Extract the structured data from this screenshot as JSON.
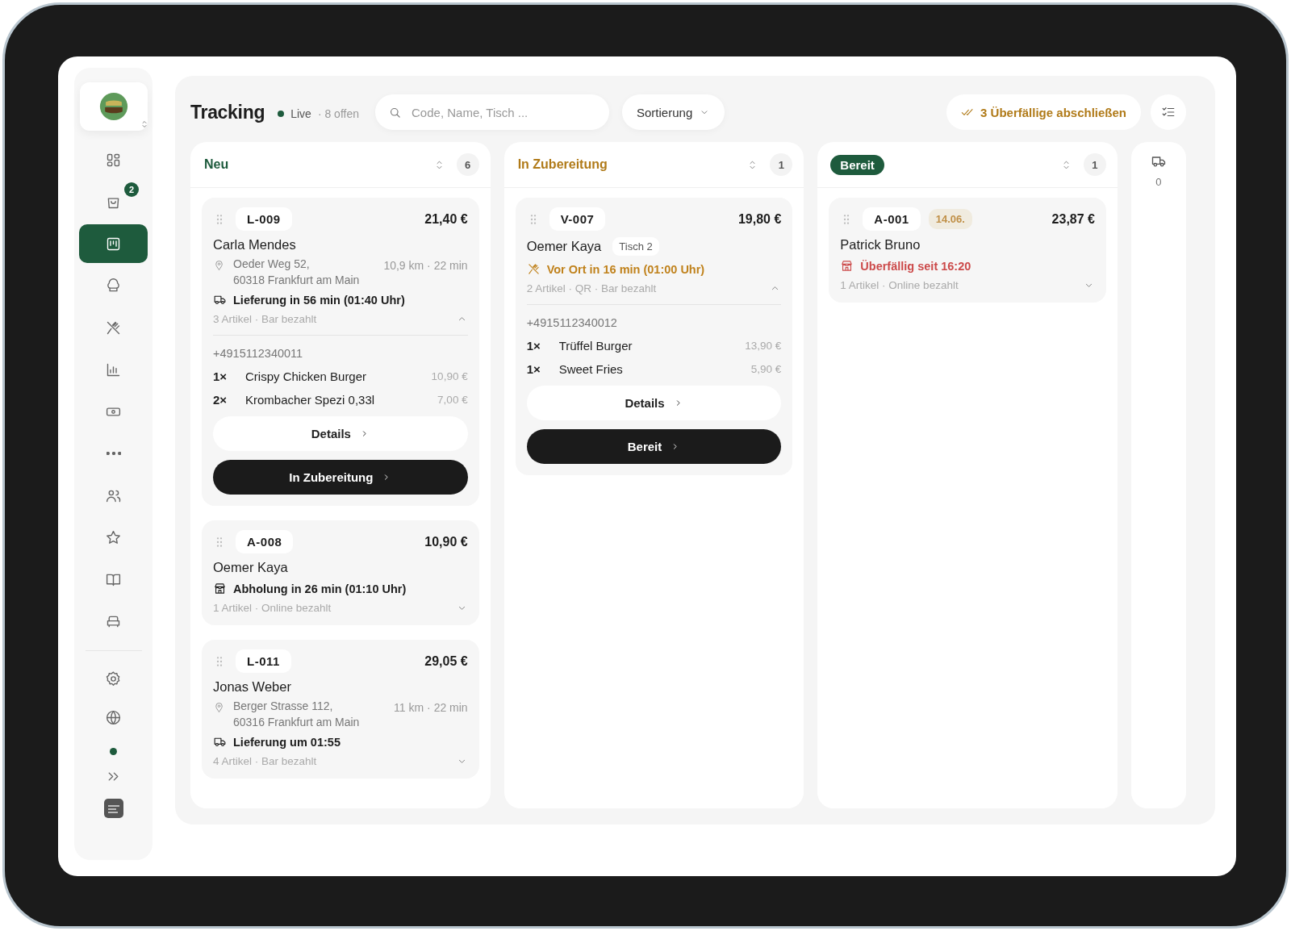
{
  "sidebar": {
    "nav": [
      {
        "kind": "grid",
        "selected": false
      },
      {
        "kind": "bag",
        "selected": false,
        "badge": "2"
      },
      {
        "kind": "board",
        "selected": true
      },
      {
        "kind": "chef",
        "selected": false
      },
      {
        "kind": "cutlery",
        "selected": false
      },
      {
        "kind": "chart",
        "selected": false
      },
      {
        "kind": "cash",
        "selected": false
      },
      {
        "kind": "more",
        "selected": false
      },
      {
        "kind": "users",
        "selected": false
      },
      {
        "kind": "star",
        "selected": false
      },
      {
        "kind": "book",
        "selected": false
      },
      {
        "kind": "sofa",
        "selected": false
      }
    ],
    "footer": [
      {
        "kind": "gear"
      },
      {
        "kind": "globe"
      }
    ],
    "online": true
  },
  "header": {
    "title": "Tracking",
    "live": {
      "label": "Live",
      "on": true
    },
    "open_count": "· 8 offen",
    "search": {
      "placeholder": "Code, Name, Tisch ..."
    },
    "sort_button": "Sortierung",
    "overdue_button": "3 Überfällige abschließen"
  },
  "columns": [
    {
      "title": "Neu",
      "kind": "new",
      "count": "6",
      "cards": [
        {
          "code": "L-009",
          "price": "21,40 €",
          "name": "Carla Mendes",
          "address": [
            "Oeder Weg 52,",
            "60318 Frankfurt am Main"
          ],
          "distance": "10,9 km · 22 min",
          "eta": {
            "kind": "delivery",
            "text": "Lieferung in 56 min (01:40 Uhr)"
          },
          "summary": "3 Artikel · Bar bezahlt",
          "expanded": true,
          "phone": "+4915112340011",
          "items": [
            {
              "qty": "1×",
              "name": "Crispy Chicken Burger",
              "price": "10,90 €"
            },
            {
              "qty": "2×",
              "name": "Krombacher Spezi 0,33l",
              "price": "7,00 €"
            }
          ],
          "details_button": "Details",
          "action_button": "In Zubereitung"
        },
        {
          "code": "A-008",
          "price": "10,90 €",
          "name": "Oemer Kaya",
          "eta": {
            "kind": "pickup",
            "text": "Abholung in 26 min (01:10 Uhr)"
          },
          "summary": "1 Artikel · Online bezahlt",
          "expanded": false
        },
        {
          "code": "L-011",
          "price": "29,05 €",
          "name": "Jonas Weber",
          "address": [
            "Berger Strasse 112,",
            "60316 Frankfurt am Main"
          ],
          "distance": "11 km · 22 min",
          "eta": {
            "kind": "delivery",
            "text": "Lieferung um 01:55"
          },
          "summary": "4 Artikel · Bar bezahlt",
          "expanded": false
        }
      ]
    },
    {
      "title": "In Zubereitung",
      "kind": "progress",
      "count": "1",
      "cards": [
        {
          "code": "V-007",
          "price": "19,80 €",
          "name": "Oemer Kaya",
          "table": "Tisch 2",
          "eta": {
            "kind": "dine-in",
            "text": "Vor Ort in 16 min (01:00 Uhr)"
          },
          "summary": "2 Artikel · QR · Bar bezahlt",
          "expanded": true,
          "phone": "+4915112340012",
          "items": [
            {
              "qty": "1×",
              "name": "Trüffel Burger",
              "price": "13,90 €"
            },
            {
              "qty": "1×",
              "name": "Sweet Fries",
              "price": "5,90 €"
            }
          ],
          "details_button": "Details",
          "action_button": "Bereit"
        }
      ]
    },
    {
      "title": "Bereit",
      "kind": "ready",
      "count": "1",
      "cards": [
        {
          "code": "A-001",
          "date": "14.06.",
          "price": "23,87 €",
          "name": "Patrick Bruno",
          "eta": {
            "kind": "overdue",
            "text": "Überfällig seit 16:20"
          },
          "summary": "1 Artikel · Online bezahlt",
          "expanded": false
        }
      ]
    }
  ],
  "delivery_column": {
    "count": "0"
  }
}
